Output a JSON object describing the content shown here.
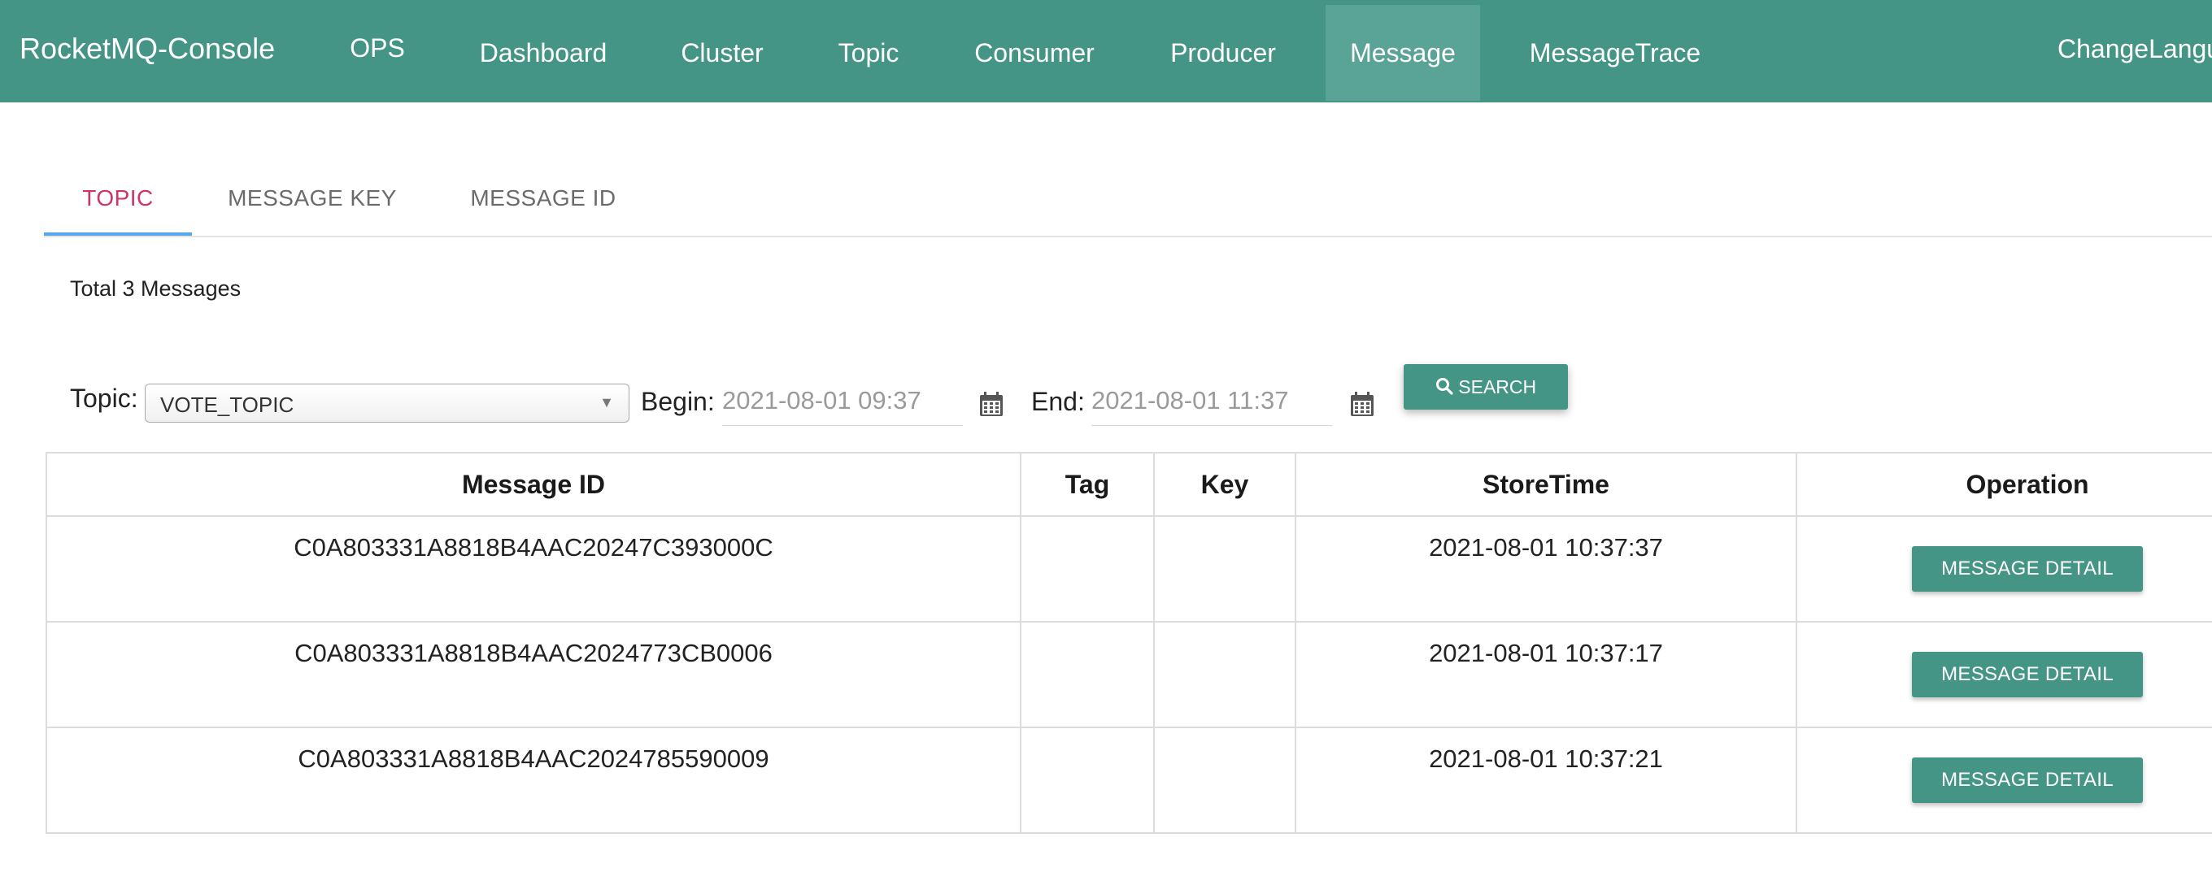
{
  "app": {
    "title": "RocketMQ-Console"
  },
  "nav": {
    "items": [
      {
        "label": "OPS"
      },
      {
        "label": "Dashboard"
      },
      {
        "label": "Cluster"
      },
      {
        "label": "Topic"
      },
      {
        "label": "Consumer"
      },
      {
        "label": "Producer"
      },
      {
        "label": "Message",
        "active": true
      },
      {
        "label": "MessageTrace"
      }
    ],
    "change_language": "ChangeLangu"
  },
  "tabs": [
    {
      "label": "TOPIC",
      "active": true
    },
    {
      "label": "MESSAGE KEY"
    },
    {
      "label": "MESSAGE ID"
    }
  ],
  "summary": {
    "total_text": "Total 3 Messages"
  },
  "filter": {
    "topic_label": "Topic:",
    "topic_value": "VOTE_TOPIC",
    "begin_label": "Begin:",
    "begin_placeholder": "2021-08-01 09:37",
    "end_label": "End:",
    "end_placeholder": "2021-08-01 11:37",
    "calendar_icon": "calendar-icon",
    "search_icon": "search-icon",
    "search_label": "SEARCH"
  },
  "table": {
    "headers": {
      "message_id": "Message ID",
      "tag": "Tag",
      "key": "Key",
      "store_time": "StoreTime",
      "operation": "Operation"
    },
    "rows": [
      {
        "message_id": "C0A803331A8818B4AAC20247C393000C",
        "tag": "",
        "key": "",
        "store_time": "2021-08-01 10:37:37",
        "action": "MESSAGE DETAIL"
      },
      {
        "message_id": "C0A803331A8818B4AAC2024773CB0006",
        "tag": "",
        "key": "",
        "store_time": "2021-08-01 10:37:17",
        "action": "MESSAGE DETAIL"
      },
      {
        "message_id": "C0A803331A8818B4AAC2024785590009",
        "tag": "",
        "key": "",
        "store_time": "2021-08-01 10:37:21",
        "action": "MESSAGE DETAIL"
      }
    ]
  },
  "colors": {
    "primary": "#459587",
    "nav_active": "#5aa497",
    "tab_active_text": "#d0336b",
    "tab_indicator": "#5aa6ea"
  }
}
